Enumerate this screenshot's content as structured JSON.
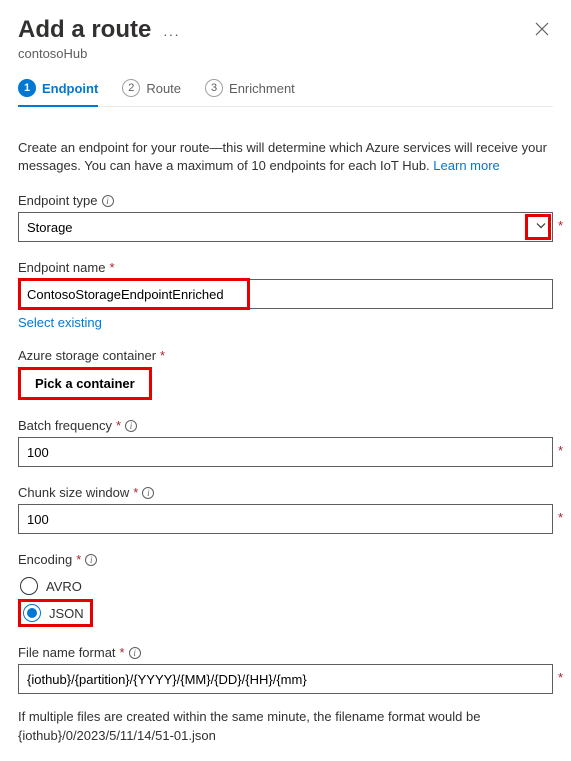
{
  "header": {
    "title": "Add a route",
    "subtitle": "contosoHub"
  },
  "tabs": {
    "items": [
      {
        "num": "1",
        "label": "Endpoint",
        "active": true
      },
      {
        "num": "2",
        "label": "Route",
        "active": false
      },
      {
        "num": "3",
        "label": "Enrichment",
        "active": false
      }
    ]
  },
  "description": {
    "text": "Create an endpoint for your route—this will determine which Azure services will receive your messages. You can have a maximum of 10 endpoints for each IoT Hub. ",
    "learn_more": "Learn more"
  },
  "fields": {
    "endpoint_type": {
      "label": "Endpoint type",
      "value": "Storage"
    },
    "endpoint_name": {
      "label": "Endpoint name",
      "value": "ContosoStorageEndpointEnriched",
      "select_existing": "Select existing"
    },
    "storage_container": {
      "label": "Azure storage container",
      "button": "Pick a container"
    },
    "batch_frequency": {
      "label": "Batch frequency",
      "value": "100"
    },
    "chunk_size": {
      "label": "Chunk size window",
      "value": "100"
    },
    "encoding": {
      "label": "Encoding",
      "options": [
        {
          "label": "AVRO",
          "selected": false
        },
        {
          "label": "JSON",
          "selected": true
        }
      ]
    },
    "file_format": {
      "label": "File name format",
      "value": "{iothub}/{partition}/{YYYY}/{MM}/{DD}/{HH}/{mm}"
    }
  },
  "footnote": "If multiple files are created within the same minute, the filename format would be {iothub}/0/2023/5/11/14/51-01.json"
}
